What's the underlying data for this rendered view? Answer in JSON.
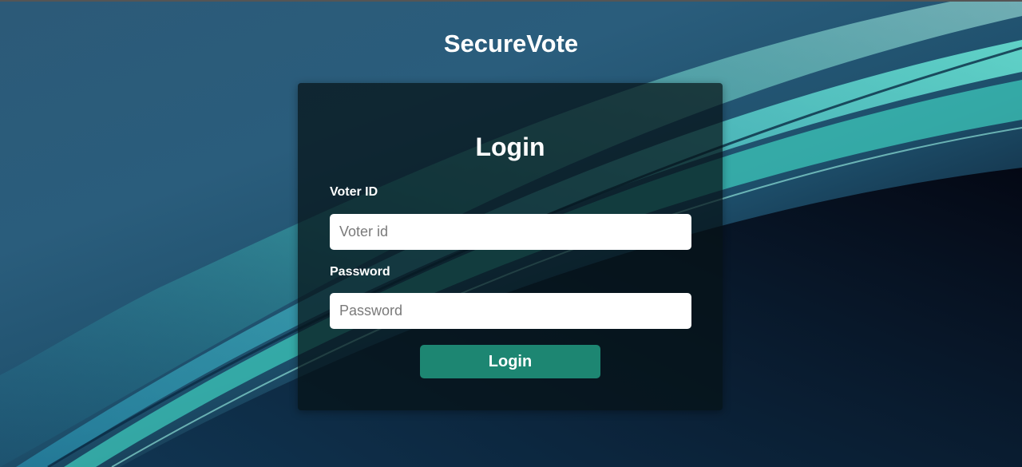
{
  "app": {
    "brand": "SecureVote"
  },
  "login": {
    "title": "Login",
    "voter_id": {
      "label": "Voter ID",
      "placeholder": "Voter id",
      "value": ""
    },
    "password": {
      "label": "Password",
      "placeholder": "Password",
      "value": ""
    },
    "submit_label": "Login"
  },
  "theme": {
    "accent": "#1d8672",
    "background_dark": "#050a16",
    "background_blue": "#2a5d7c",
    "wave_teal": "#4fe0c8"
  }
}
